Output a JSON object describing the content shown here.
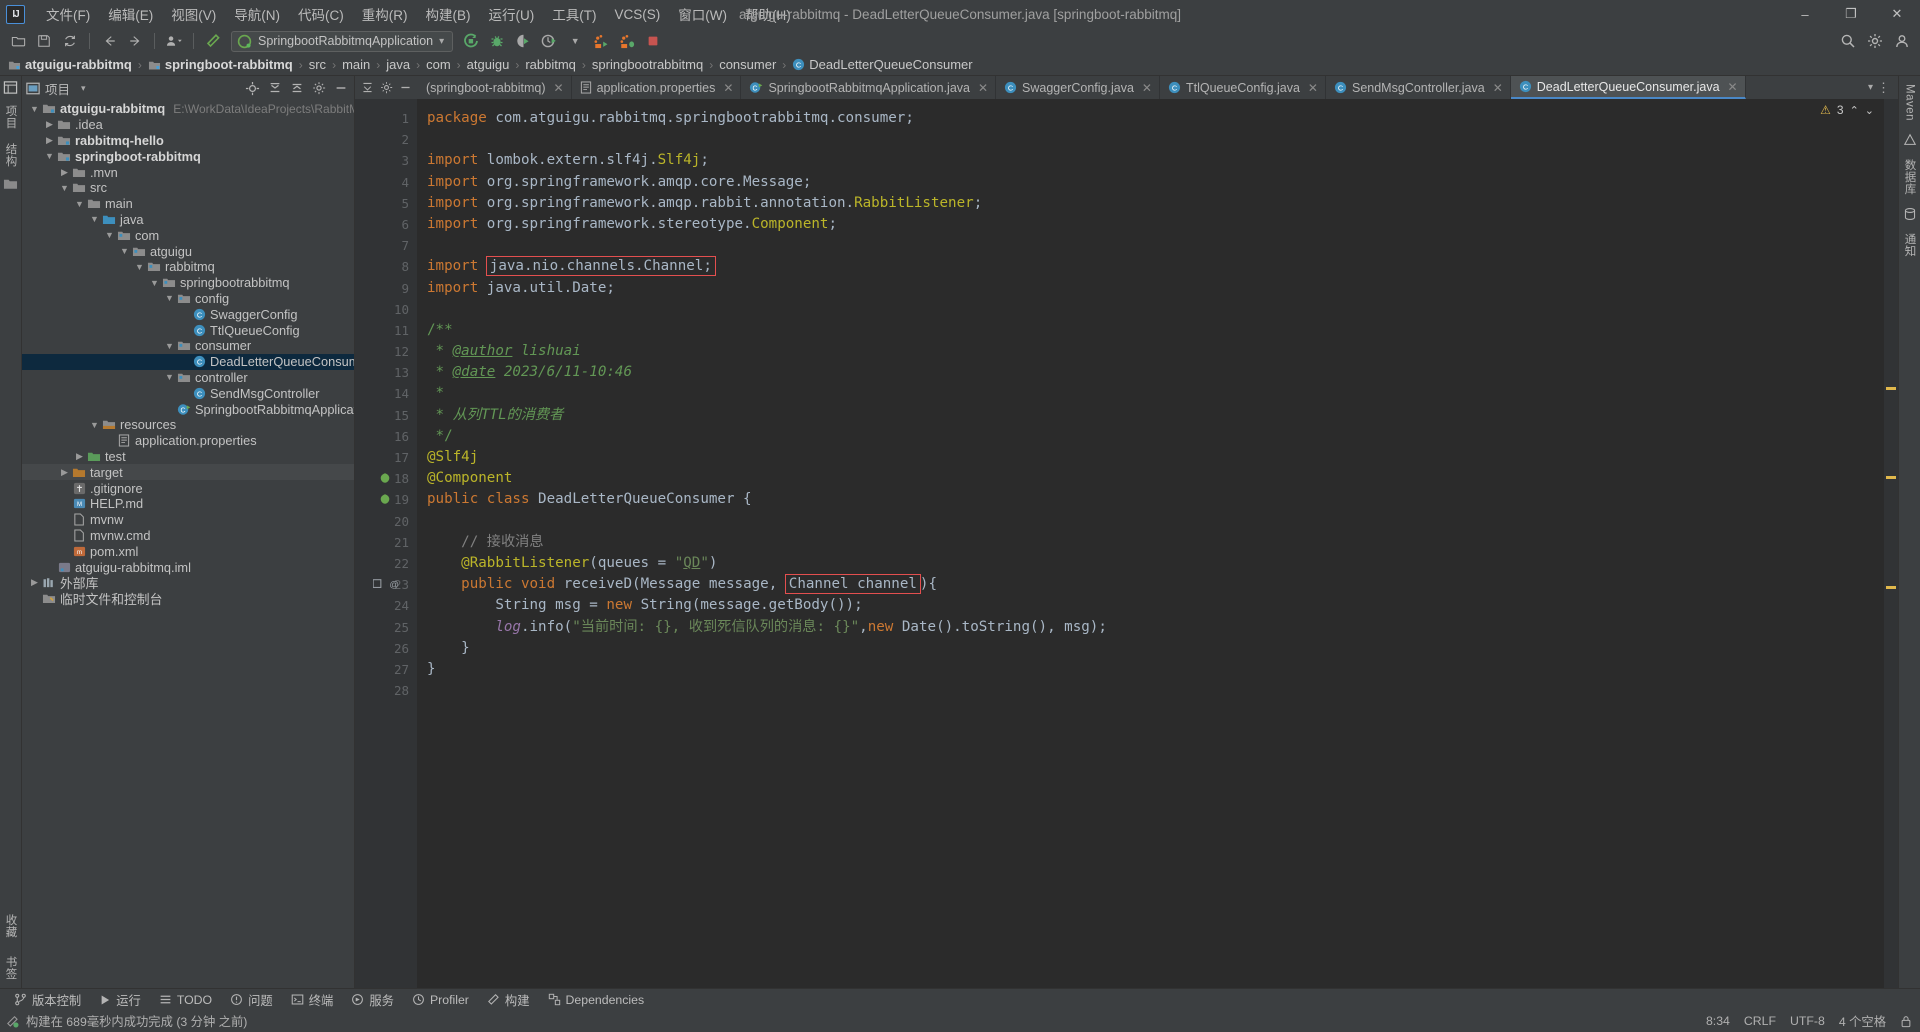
{
  "window": {
    "title": "atguigu-rabbitmq - DeadLetterQueueConsumer.java [springboot-rabbitmq]",
    "minimize": "–",
    "maximize": "❐",
    "close": "✕"
  },
  "menubar": {
    "logo": "IJ",
    "items": [
      {
        "label": "文件(F)",
        "name": "menu-file"
      },
      {
        "label": "编辑(E)",
        "name": "menu-edit"
      },
      {
        "label": "视图(V)",
        "name": "menu-view"
      },
      {
        "label": "导航(N)",
        "name": "menu-navigate"
      },
      {
        "label": "代码(C)",
        "name": "menu-code"
      },
      {
        "label": "重构(R)",
        "name": "menu-refactor"
      },
      {
        "label": "构建(B)",
        "name": "menu-build"
      },
      {
        "label": "运行(U)",
        "name": "menu-run"
      },
      {
        "label": "工具(T)",
        "name": "menu-tools"
      },
      {
        "label": "VCS(S)",
        "name": "menu-vcs"
      },
      {
        "label": "窗口(W)",
        "name": "menu-window"
      },
      {
        "label": "帮助(H)",
        "name": "menu-help"
      }
    ]
  },
  "toolbar": {
    "run_config": "SpringbootRabbitmqApplication",
    "dropdown_caret": "▾",
    "icons": [
      "open-folder-icon",
      "save-icon",
      "sync-icon",
      "back-arrow-icon",
      "forward-arrow-icon",
      "profile-dropdown-icon",
      "build-hammer-icon"
    ],
    "right_icons": [
      "run-icon",
      "debug-icon",
      "run-coverage-icon",
      "profiler-icon",
      "profiler-dropdown-icon",
      "attach-icon",
      "rerun-icon",
      "stop-icon"
    ],
    "search_icon": "search-icon",
    "settings_icon": "gear-icon",
    "account_icon": "account-icon"
  },
  "breadcrumb": {
    "items": [
      {
        "label": "atguigu-rabbitmq",
        "bold": true,
        "icon": "module-icon"
      },
      {
        "label": "springboot-rabbitmq",
        "bold": true,
        "icon": "module-icon"
      },
      {
        "label": "src",
        "bold": false,
        "icon": ""
      },
      {
        "label": "main",
        "bold": false,
        "icon": ""
      },
      {
        "label": "java",
        "bold": false,
        "icon": ""
      },
      {
        "label": "com",
        "bold": false,
        "icon": ""
      },
      {
        "label": "atguigu",
        "bold": false,
        "icon": ""
      },
      {
        "label": "rabbitmq",
        "bold": false,
        "icon": ""
      },
      {
        "label": "springbootrabbitmq",
        "bold": false,
        "icon": ""
      },
      {
        "label": "consumer",
        "bold": false,
        "icon": ""
      },
      {
        "label": "DeadLetterQueueConsumer",
        "bold": false,
        "icon": "class-icon"
      }
    ],
    "separator": "›"
  },
  "project_panel": {
    "title": "项目",
    "caret": "▾",
    "actions": [
      "locate-icon",
      "collapse-all-icon",
      "expand-icon",
      "settings-gear-icon",
      "hide-icon"
    ],
    "tree": [
      {
        "indent": 0,
        "arrow": "down",
        "icon": "module",
        "label": "atguigu-rabbitmq",
        "bold": true,
        "path": "E:\\WorkData\\IdeaProjects\\RabbitMQ\\at"
      },
      {
        "indent": 1,
        "arrow": "right",
        "icon": "folder",
        "label": ".idea",
        "bold": false,
        "path": ""
      },
      {
        "indent": 1,
        "arrow": "right",
        "icon": "module",
        "label": "rabbitmq-hello",
        "bold": true,
        "path": ""
      },
      {
        "indent": 1,
        "arrow": "down",
        "icon": "module",
        "label": "springboot-rabbitmq",
        "bold": true,
        "path": ""
      },
      {
        "indent": 2,
        "arrow": "right",
        "icon": "folder",
        "label": ".mvn",
        "bold": false,
        "path": ""
      },
      {
        "indent": 2,
        "arrow": "down",
        "icon": "folder",
        "label": "src",
        "bold": false,
        "path": ""
      },
      {
        "indent": 3,
        "arrow": "down",
        "icon": "folder",
        "label": "main",
        "bold": false,
        "path": ""
      },
      {
        "indent": 4,
        "arrow": "down",
        "icon": "source-folder",
        "label": "java",
        "bold": false,
        "path": ""
      },
      {
        "indent": 5,
        "arrow": "down",
        "icon": "package",
        "label": "com",
        "bold": false,
        "path": ""
      },
      {
        "indent": 6,
        "arrow": "down",
        "icon": "package",
        "label": "atguigu",
        "bold": false,
        "path": ""
      },
      {
        "indent": 7,
        "arrow": "down",
        "icon": "package",
        "label": "rabbitmq",
        "bold": false,
        "path": ""
      },
      {
        "indent": 8,
        "arrow": "down",
        "icon": "package",
        "label": "springbootrabbitmq",
        "bold": false,
        "path": ""
      },
      {
        "indent": 9,
        "arrow": "down",
        "icon": "package",
        "label": "config",
        "bold": false,
        "path": ""
      },
      {
        "indent": 10,
        "arrow": "",
        "icon": "class",
        "label": "SwaggerConfig",
        "bold": false,
        "path": ""
      },
      {
        "indent": 10,
        "arrow": "",
        "icon": "class",
        "label": "TtlQueueConfig",
        "bold": false,
        "path": ""
      },
      {
        "indent": 9,
        "arrow": "down",
        "icon": "package",
        "label": "consumer",
        "bold": false,
        "path": ""
      },
      {
        "indent": 10,
        "arrow": "",
        "icon": "class",
        "label": "DeadLetterQueueConsumer",
        "bold": false,
        "path": "",
        "selected": true
      },
      {
        "indent": 9,
        "arrow": "down",
        "icon": "package",
        "label": "controller",
        "bold": false,
        "path": ""
      },
      {
        "indent": 10,
        "arrow": "",
        "icon": "class",
        "label": "SendMsgController",
        "bold": false,
        "path": ""
      },
      {
        "indent": 9,
        "arrow": "",
        "icon": "spring-class",
        "label": "SpringbootRabbitmqApplication",
        "bold": false,
        "path": ""
      },
      {
        "indent": 4,
        "arrow": "down",
        "icon": "resource-folder",
        "label": "resources",
        "bold": false,
        "path": ""
      },
      {
        "indent": 5,
        "arrow": "",
        "icon": "properties",
        "label": "application.properties",
        "bold": false,
        "path": ""
      },
      {
        "indent": 3,
        "arrow": "right",
        "icon": "test-folder",
        "label": "test",
        "bold": false,
        "path": ""
      },
      {
        "indent": 2,
        "arrow": "right",
        "icon": "target-folder",
        "label": "target",
        "bold": false,
        "path": "",
        "highlight": true
      },
      {
        "indent": 2,
        "arrow": "",
        "icon": "git",
        "label": ".gitignore",
        "bold": false,
        "path": ""
      },
      {
        "indent": 2,
        "arrow": "",
        "icon": "md",
        "label": "HELP.md",
        "bold": false,
        "path": ""
      },
      {
        "indent": 2,
        "arrow": "",
        "icon": "file",
        "label": "mvnw",
        "bold": false,
        "path": ""
      },
      {
        "indent": 2,
        "arrow": "",
        "icon": "file",
        "label": "mvnw.cmd",
        "bold": false,
        "path": ""
      },
      {
        "indent": 2,
        "arrow": "",
        "icon": "maven",
        "label": "pom.xml",
        "bold": false,
        "path": ""
      },
      {
        "indent": 1,
        "arrow": "",
        "icon": "iml",
        "label": "atguigu-rabbitmq.iml",
        "bold": false,
        "path": ""
      },
      {
        "indent": 0,
        "arrow": "right",
        "icon": "library",
        "label": "外部库",
        "bold": false,
        "path": ""
      },
      {
        "indent": 0,
        "arrow": "",
        "icon": "scratch",
        "label": "临时文件和控制台",
        "bold": false,
        "path": ""
      }
    ]
  },
  "editor_tabs": {
    "actions": [
      "collapse-icon",
      "settings-icon",
      "minimize-icon"
    ],
    "tabs": [
      {
        "label": "(springboot-rabbitmq)",
        "icon": "",
        "active": false,
        "close": "✕"
      },
      {
        "label": "application.properties",
        "icon": "properties-icon",
        "active": false,
        "close": "✕"
      },
      {
        "label": "SpringbootRabbitmqApplication.java",
        "icon": "spring-icon",
        "active": false,
        "close": "✕"
      },
      {
        "label": "SwaggerConfig.java",
        "icon": "class-icon",
        "active": false,
        "close": "✕"
      },
      {
        "label": "TtlQueueConfig.java",
        "icon": "class-icon",
        "active": false,
        "close": "✕"
      },
      {
        "label": "SendMsgController.java",
        "icon": "class-icon",
        "active": false,
        "close": "✕"
      },
      {
        "label": "DeadLetterQueueConsumer.java",
        "icon": "class-icon",
        "active": true,
        "close": "✕"
      }
    ],
    "overflow_caret": "▾",
    "more_icon": "⋮"
  },
  "inspection": {
    "warning_icon": "⚠",
    "warning_count": "3",
    "up_caret": "⌃",
    "down_caret": "⌄"
  },
  "code": {
    "line_numbers": [
      "1",
      "2",
      "3",
      "4",
      "5",
      "6",
      "7",
      "8",
      "9",
      "10",
      "11",
      "12",
      "13",
      "14",
      "15",
      "16",
      "17",
      "18",
      "19",
      "20",
      "21",
      "22",
      "23",
      "24",
      "25",
      "26",
      "27",
      "28"
    ],
    "lines": [
      "package com.atguigu.rabbitmq.springbootrabbitmq.consumer;",
      "",
      "import lombok.extern.slf4j.Slf4j;",
      "import org.springframework.amqp.core.Message;",
      "import org.springframework.amqp.rabbit.annotation.RabbitListener;",
      "import org.springframework.stereotype.Component;",
      "",
      "import java.nio.channels.Channel;",
      "import java.util.Date;",
      "",
      "/**",
      " * @author lishuai",
      " * @date 2023/6/11-10:46",
      " *",
      " * 从列TTL的消费者",
      " */",
      "@Slf4j",
      "@Component",
      "public class DeadLetterQueueConsumer {",
      "",
      "    // 接收消息",
      "    @RabbitListener(queues = \"QD\")",
      "    public void receiveD(Message message, Channel channel){",
      "        String msg = new String(message.getBody());",
      "        log.info(\"当前时间: {}, 收到死信队列的消息: {}\",new Date().toString(), msg);",
      "    }",
      "}",
      ""
    ]
  },
  "bottom_toolbar": {
    "items": [
      {
        "label": "版本控制",
        "icon": "vcs-icon",
        "name": "tool-version-control"
      },
      {
        "label": "运行",
        "icon": "run-icon",
        "name": "tool-run"
      },
      {
        "label": "TODO",
        "icon": "todo-icon",
        "name": "tool-todo"
      },
      {
        "label": "问题",
        "icon": "problems-icon",
        "name": "tool-problems"
      },
      {
        "label": "终端",
        "icon": "terminal-icon",
        "name": "tool-terminal"
      },
      {
        "label": "服务",
        "icon": "services-icon",
        "name": "tool-services"
      },
      {
        "label": "Profiler",
        "icon": "profiler-icon",
        "name": "tool-profiler"
      },
      {
        "label": "构建",
        "icon": "build-icon",
        "name": "tool-build"
      },
      {
        "label": "Dependencies",
        "icon": "dependencies-icon",
        "name": "tool-dependencies"
      }
    ]
  },
  "statusbar": {
    "message": "构建在 689毫秒内成功完成 (3 分钟 之前)",
    "message_icon": "build-success-icon",
    "caret_position": "8:34",
    "line_separator": "CRLF",
    "encoding": "UTF-8",
    "indent": "4 个空格",
    "branch": "",
    "lock_icon": "lock-icon",
    "right_items": [
      "8:34",
      "CRLF",
      "UTF-8",
      "4 个空格"
    ]
  },
  "rails": {
    "left_top": [
      "项目",
      "结构"
    ],
    "left_bottom": [
      "收藏",
      "书签"
    ],
    "right": [
      "Maven",
      "数据库",
      "通知"
    ]
  },
  "colors": {
    "bg_panel": "#3c3f41",
    "bg_editor": "#2b2b2b",
    "bg_gutter": "#313335",
    "accent_blue": "#4a88c7",
    "selection": "#0d293e",
    "keyword": "#cc7832",
    "string": "#6a8759",
    "comment": "#808080",
    "javadoc": "#629755",
    "annotation": "#bbb529",
    "field": "#9876aa",
    "number": "#6897bb",
    "plain": "#a9b7c6",
    "error_box": "#e34f4f"
  }
}
